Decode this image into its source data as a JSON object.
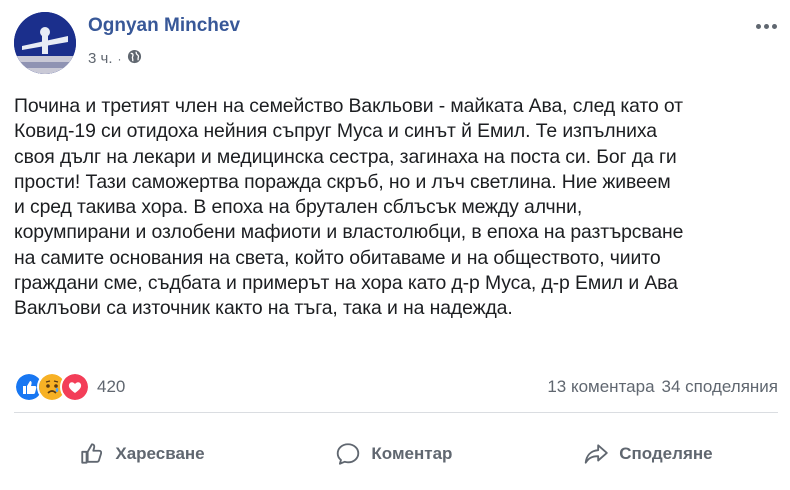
{
  "post": {
    "author": "Ognyan Minchev",
    "time": "3 ч.",
    "separator": "·",
    "privacy_icon": "globe-icon",
    "text": "Почина и третият член на семейство Вакльови - майката Ава, след като от\nКовид-19 си отидоха нейния съпруг Муса и синът й Емил. Те изпълниха\nсвоя дълг на лекари и медицинска сестра, загинаха на поста си. Бог да ги\nпрости! Тази саможертва поражда скръб, но и лъч светлина. Ние живеем\nи сред такива хора. В епоха на брутален сблъсък между алчни,\nкорумпирани и озлобени мафиоти и властолюбци, в епоха на разтърсване\nна самите основания на света, който обитаваме и на обществото, чиито\nграждани сме, съдбата и примерът на хора като д-р Муса, д-р Емил и Ава\nВаклъови са източник както на тъга, така и на надежда."
  },
  "reactions": {
    "icons": [
      "like-icon",
      "sad-icon",
      "love-icon"
    ],
    "count": "420",
    "comments": "13 коментара",
    "shares": "34 споделяния"
  },
  "actions": {
    "like_label": "Харесване",
    "comment_label": "Коментар",
    "share_label": "Споделяне"
  },
  "colors": {
    "author": "#385898",
    "secondary": "#606770",
    "like": "#1877f2",
    "sad": "#f7b125",
    "love": "#f33e58"
  }
}
